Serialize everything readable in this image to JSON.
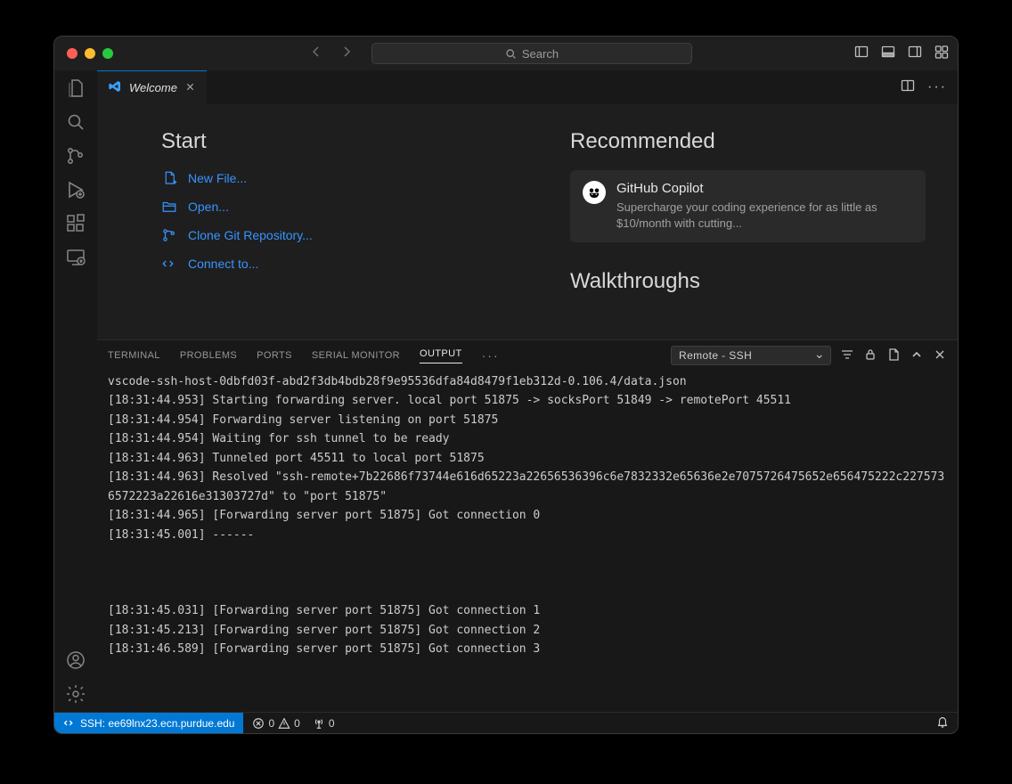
{
  "titlebar": {
    "search_placeholder": "Search"
  },
  "tab": {
    "title": "Welcome"
  },
  "welcome": {
    "start_heading": "Start",
    "start_items": [
      "New File...",
      "Open...",
      "Clone Git Repository...",
      "Connect to..."
    ],
    "recommended_heading": "Recommended",
    "rec_title": "GitHub Copilot",
    "rec_desc": "Supercharge your coding experience for as little as $10/month with cutting...",
    "walkthroughs_heading": "Walkthroughs"
  },
  "panel": {
    "tabs": [
      "TERMINAL",
      "PROBLEMS",
      "PORTS",
      "SERIAL MONITOR",
      "OUTPUT"
    ],
    "active_tab": "OUTPUT",
    "channel": "Remote - SSH",
    "log": "vscode-ssh-host-0dbfd03f-abd2f3db4bdb28f9e95536dfa84d8479f1eb312d-0.106.4/data.json\n[18:31:44.953] Starting forwarding server. local port 51875 -> socksPort 51849 -> remotePort 45511\n[18:31:44.954] Forwarding server listening on port 51875\n[18:31:44.954] Waiting for ssh tunnel to be ready\n[18:31:44.963] Tunneled port 45511 to local port 51875\n[18:31:44.963] Resolved \"ssh-remote+7b22686f73744e616d65223a22656536396c6e7832332e65636e2e7075726475652e656475222c2275736572223a22616e31303727d\" to \"port 51875\"\n[18:31:44.965] [Forwarding server port 51875] Got connection 0\n[18:31:45.001] ------\n\n\n\n[18:31:45.031] [Forwarding server port 51875] Got connection 1\n[18:31:45.213] [Forwarding server port 51875] Got connection 2\n[18:31:46.589] [Forwarding server port 51875] Got connection 3"
  },
  "statusbar": {
    "remote": "SSH: ee69lnx23.ecn.purdue.edu",
    "errors": "0",
    "warnings": "0",
    "ports": "0"
  }
}
